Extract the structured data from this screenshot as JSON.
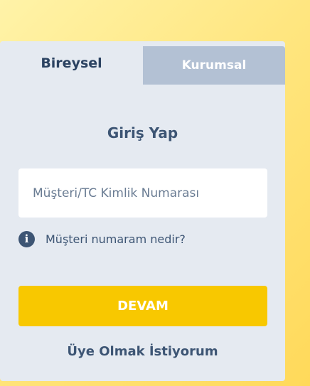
{
  "tabs": {
    "individual": "Bireysel",
    "corporate": "Kurumsal"
  },
  "login": {
    "title": "Giriş Yap",
    "customer_field": {
      "value": "",
      "placeholder": "Müşteri/TC Kimlik Numarası"
    },
    "help_icon": "info-icon",
    "help_text": "Müşteri numaram nedir?",
    "continue_label": "DEVAM",
    "register_label": "Üye Olmak İstiyorum"
  },
  "colors": {
    "accent": "#f8c800",
    "text_primary": "#3d5574",
    "tab_inactive": "#b3c1d4",
    "panel": "#e5eaf1"
  }
}
